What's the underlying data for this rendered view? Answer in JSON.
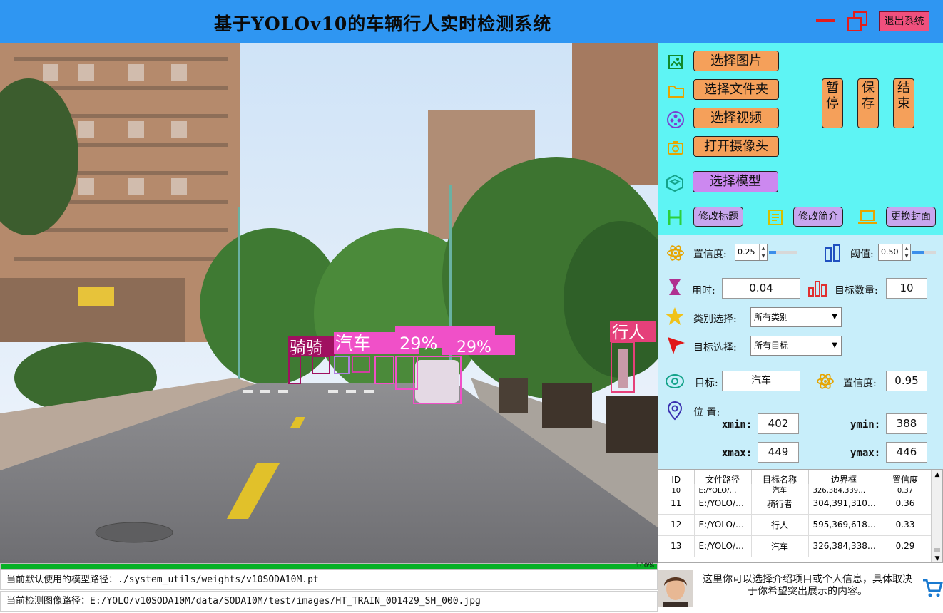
{
  "window": {
    "title": "基于YOLOv10的车辆行人实时检测系统",
    "exit_label": "退出系统"
  },
  "viewer": {
    "detections": [
      {
        "label": "骑骑",
        "color": "#a01060"
      },
      {
        "label": "汽车",
        "color": "#f050c8"
      },
      {
        "label": "29%",
        "color": "#f050c8"
      },
      {
        "label": "行人",
        "color": "#e5407a"
      }
    ]
  },
  "progress": {
    "value": 100,
    "text": "100%"
  },
  "paths": {
    "model": "当前默认使用的模型路径：./system_utils/weights/v10SODA10M.pt",
    "image": "当前检测图像路径：E:/YOLO/v10SODA10M/data/SODA10M/test/images/HT_TRAIN_001429_SH_000.jpg"
  },
  "controls": {
    "select_image": "选择图片",
    "select_folder": "选择文件夹",
    "select_video": "选择视频",
    "open_camera": "打开摄像头",
    "select_model": "选择模型",
    "pause": "暂停",
    "save": "保存",
    "end": "结束",
    "edit_title": "修改标题",
    "edit_intro": "修改简介",
    "change_cover": "更换封面"
  },
  "params": {
    "confidence_label": "置信度:",
    "confidence_value": "0.25",
    "confidence_slider": 0.25,
    "iou_label": "阈值:",
    "iou_value": "0.50",
    "iou_slider": 0.5,
    "time_label": "用时:",
    "time_value": "0.04",
    "count_label": "目标数量:",
    "count_value": "10",
    "class_label": "类别选择:",
    "class_value": "所有类别",
    "target_label": "目标选择:",
    "target_value": "所有目标"
  },
  "result": {
    "target_label": "目标:",
    "target_value": "汽车",
    "conf_label": "置信度:",
    "conf_value": "0.95",
    "position_label": "位 置:",
    "xmin_label": "xmin:",
    "xmin": "402",
    "ymin_label": "ymin:",
    "ymin": "388",
    "xmax_label": "xmax:",
    "xmax": "449",
    "ymax_label": "ymax:",
    "ymax": "446"
  },
  "table": {
    "headers": [
      "ID",
      "文件路径",
      "目标名称",
      "边界框",
      "置信度"
    ],
    "partial_row": [
      "10",
      "E:/YOLO/…",
      "汽车",
      "326,384,339…",
      "0.37"
    ],
    "rows": [
      [
        "11",
        "E:/YOLO/…",
        "骑行者",
        "304,391,310…",
        "0.36"
      ],
      [
        "12",
        "E:/YOLO/…",
        "行人",
        "595,369,618…",
        "0.33"
      ],
      [
        "13",
        "E:/YOLO/…",
        "汽车",
        "326,384,338…",
        "0.29"
      ]
    ]
  },
  "intro": {
    "text": "这里你可以选择介绍项目或个人信息，具体取决于你希望突出展示的内容。"
  },
  "colors": {
    "title_bar": "#2f96f2",
    "top_panel": "#5ef4f4",
    "mid_panel": "#c8eefa",
    "button_orange": "#f5a05a",
    "button_purple": "#cc88f0",
    "exit_button": "#f0507d",
    "progress": "#06b025"
  }
}
